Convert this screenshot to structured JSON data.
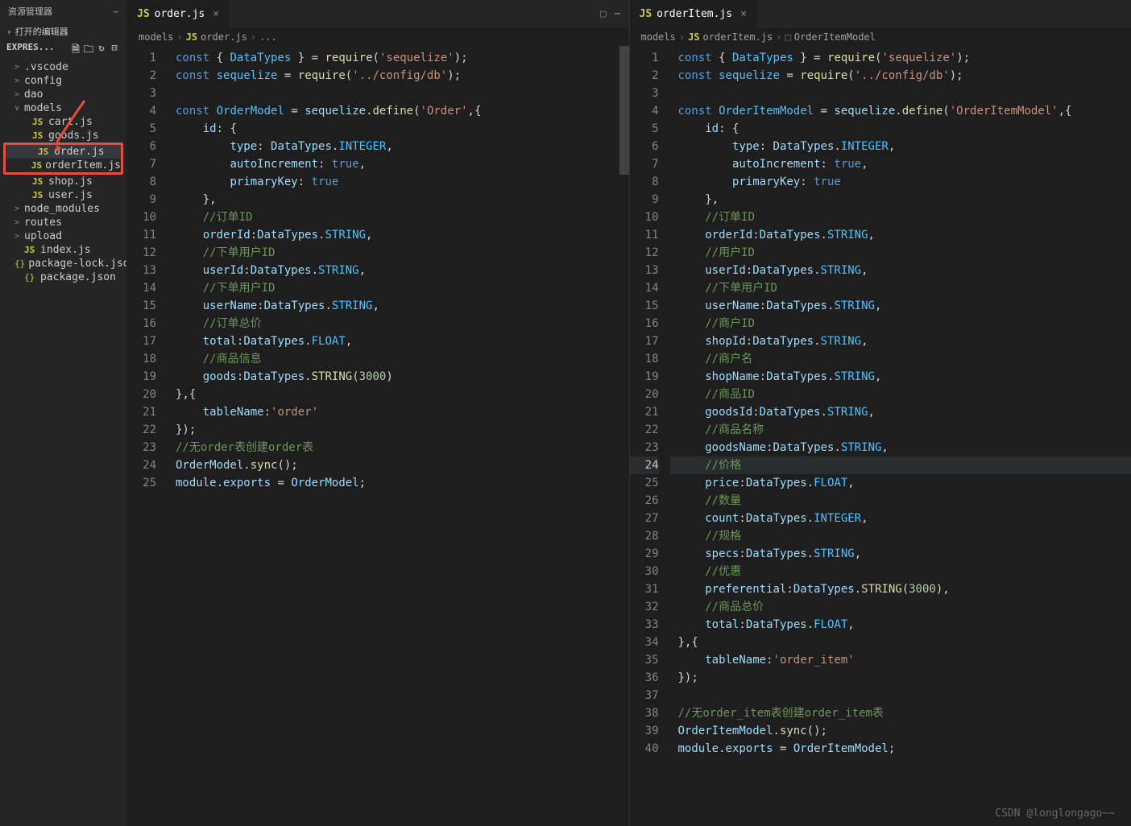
{
  "sidebar": {
    "title": "资源管理器",
    "openEditors": "打开的编辑器",
    "projectName": "EXPRES...",
    "items": [
      {
        "name": ".vscode",
        "type": "folder",
        "chev": ">"
      },
      {
        "name": "config",
        "type": "folder",
        "chev": ">"
      },
      {
        "name": "dao",
        "type": "folder",
        "chev": ">"
      },
      {
        "name": "models",
        "type": "folder",
        "chev": "∨",
        "open": true
      },
      {
        "name": "cart.js",
        "type": "js",
        "nested": true
      },
      {
        "name": "goods.js",
        "type": "js",
        "nested": true
      },
      {
        "name": "order.js",
        "type": "js",
        "nested": true,
        "hl": true,
        "selected": true
      },
      {
        "name": "orderItem.js",
        "type": "js",
        "nested": true,
        "hl": true
      },
      {
        "name": "shop.js",
        "type": "js",
        "nested": true
      },
      {
        "name": "user.js",
        "type": "js",
        "nested": true
      },
      {
        "name": "node_modules",
        "type": "folder",
        "chev": ">"
      },
      {
        "name": "routes",
        "type": "folder",
        "chev": ">"
      },
      {
        "name": "upload",
        "type": "folder",
        "chev": ">"
      },
      {
        "name": "index.js",
        "type": "js"
      },
      {
        "name": "package-lock.json",
        "type": "json"
      },
      {
        "name": "package.json",
        "type": "json"
      }
    ]
  },
  "leftPane": {
    "tab": "order.js",
    "breadcrumb": [
      "models",
      "order.js",
      "..."
    ],
    "lines": 25,
    "code": [
      "<span class='kw'>const</span> <span class='pn'>{</span> <span class='dc'>DataTypes</span> <span class='pn'>}</span> <span class='op'>=</span> <span class='fn'>require</span><span class='pn'>(</span><span class='str'>'sequelize'</span><span class='pn'>);</span>",
      "<span class='kw'>const</span> <span class='dc'>sequelize</span> <span class='op'>=</span> <span class='fn'>require</span><span class='pn'>(</span><span class='str'>'../config/db'</span><span class='pn'>);</span>",
      "",
      "<span class='kw'>const</span> <span class='dc'>OrderModel</span> <span class='op'>=</span> <span class='var'>sequelize</span><span class='pn'>.</span><span class='fn'>define</span><span class='pn'>(</span><span class='str'>'Order'</span><span class='pn'>,{</span>",
      "    <span class='prop'>id</span><span class='pn'>:</span> <span class='pn'>{</span>",
      "        <span class='prop'>type</span><span class='pn'>:</span> <span class='var'>DataTypes</span><span class='pn'>.</span><span class='dc'>INTEGER</span><span class='pn'>,</span>",
      "        <span class='prop'>autoIncrement</span><span class='pn'>:</span> <span class='kw'>true</span><span class='pn'>,</span>",
      "        <span class='prop'>primaryKey</span><span class='pn'>:</span> <span class='kw'>true</span>",
      "    <span class='pn'>},</span>",
      "    <span class='cmt'>//订单ID</span>",
      "    <span class='prop'>orderId</span><span class='pn'>:</span><span class='var'>DataTypes</span><span class='pn'>.</span><span class='dc'>STRING</span><span class='pn'>,</span>",
      "    <span class='cmt'>//下单用户ID</span>",
      "    <span class='prop'>userId</span><span class='pn'>:</span><span class='var'>DataTypes</span><span class='pn'>.</span><span class='dc'>STRING</span><span class='pn'>,</span>",
      "    <span class='cmt'>//下单用户ID</span>",
      "    <span class='prop'>userName</span><span class='pn'>:</span><span class='var'>DataTypes</span><span class='pn'>.</span><span class='dc'>STRING</span><span class='pn'>,</span>",
      "    <span class='cmt'>//订单总价</span>",
      "    <span class='prop'>total</span><span class='pn'>:</span><span class='var'>DataTypes</span><span class='pn'>.</span><span class='dc'>FLOAT</span><span class='pn'>,</span>",
      "    <span class='cmt'>//商品信息</span>",
      "    <span class='prop'>goods</span><span class='pn'>:</span><span class='var'>DataTypes</span><span class='pn'>.</span><span class='fn'>STRING</span><span class='pn'>(</span><span class='num'>3000</span><span class='pn'>)</span>",
      "<span class='pn'>},{</span>",
      "    <span class='prop'>tableName</span><span class='pn'>:</span><span class='str'>'order'</span>",
      "<span class='pn'>});</span>",
      "<span class='cmt'>//无order表创建order表</span>",
      "<span class='var'>OrderModel</span><span class='pn'>.</span><span class='fn'>sync</span><span class='pn'>();</span>",
      "<span class='var'>module</span><span class='pn'>.</span><span class='var'>exports</span> <span class='op'>=</span> <span class='var'>OrderModel</span><span class='pn'>;</span>"
    ]
  },
  "rightPane": {
    "tab": "orderItem.js",
    "breadcrumb": [
      "models",
      "orderItem.js",
      "OrderItemModel"
    ],
    "lines": 40,
    "currentLine": 24,
    "code": [
      "<span class='kw'>const</span> <span class='pn'>{</span> <span class='dc'>DataTypes</span> <span class='pn'>}</span> <span class='op'>=</span> <span class='fn'>require</span><span class='pn'>(</span><span class='str'>'sequelize'</span><span class='pn'>);</span>",
      "<span class='kw'>const</span> <span class='dc'>sequelize</span> <span class='op'>=</span> <span class='fn'>require</span><span class='pn'>(</span><span class='str'>'../config/db'</span><span class='pn'>);</span>",
      "",
      "<span class='kw'>const</span> <span class='dc'>OrderItemModel</span> <span class='op'>=</span> <span class='var'>sequelize</span><span class='pn'>.</span><span class='fn'>define</span><span class='pn'>(</span><span class='str'>'OrderItemModel'</span><span class='pn'>,{</span>",
      "    <span class='prop'>id</span><span class='pn'>:</span> <span class='pn'>{</span>",
      "        <span class='prop'>type</span><span class='pn'>:</span> <span class='var'>DataTypes</span><span class='pn'>.</span><span class='dc'>INTEGER</span><span class='pn'>,</span>",
      "        <span class='prop'>autoIncrement</span><span class='pn'>:</span> <span class='kw'>true</span><span class='pn'>,</span>",
      "        <span class='prop'>primaryKey</span><span class='pn'>:</span> <span class='kw'>true</span>",
      "    <span class='pn'>},</span>",
      "    <span class='cmt'>//订单ID</span>",
      "    <span class='prop'>orderId</span><span class='pn'>:</span><span class='var'>DataTypes</span><span class='pn'>.</span><span class='dc'>STRING</span><span class='pn'>,</span>",
      "    <span class='cmt'>//用户ID</span>",
      "    <span class='prop'>userId</span><span class='pn'>:</span><span class='var'>DataTypes</span><span class='pn'>.</span><span class='dc'>STRING</span><span class='pn'>,</span>",
      "    <span class='cmt'>//下单用户ID</span>",
      "    <span class='prop'>userName</span><span class='pn'>:</span><span class='var'>DataTypes</span><span class='pn'>.</span><span class='dc'>STRING</span><span class='pn'>,</span>",
      "    <span class='cmt'>//商户ID</span>",
      "    <span class='prop'>shopId</span><span class='pn'>:</span><span class='var'>DataTypes</span><span class='pn'>.</span><span class='dc'>STRING</span><span class='pn'>,</span>",
      "    <span class='cmt'>//商户名</span>",
      "    <span class='prop'>shopName</span><span class='pn'>:</span><span class='var'>DataTypes</span><span class='pn'>.</span><span class='dc'>STRING</span><span class='pn'>,</span>",
      "    <span class='cmt'>//商品ID</span>",
      "    <span class='prop'>goodsId</span><span class='pn'>:</span><span class='var'>DataTypes</span><span class='pn'>.</span><span class='dc'>STRING</span><span class='pn'>,</span>",
      "    <span class='cmt'>//商品名称</span>",
      "    <span class='prop'>goodsName</span><span class='pn'>:</span><span class='var'>DataTypes</span><span class='pn'>.</span><span class='dc'>STRING</span><span class='pn'>,</span>",
      "    <span class='cmt'>//价格</span>",
      "    <span class='prop'>price</span><span class='pn'>:</span><span class='var'>DataTypes</span><span class='pn'>.</span><span class='dc'>FLOAT</span><span class='pn'>,</span>",
      "    <span class='cmt'>//数量</span>",
      "    <span class='prop'>count</span><span class='pn'>:</span><span class='var'>DataTypes</span><span class='pn'>.</span><span class='dc'>INTEGER</span><span class='pn'>,</span>",
      "    <span class='cmt'>//规格</span>",
      "    <span class='prop'>specs</span><span class='pn'>:</span><span class='var'>DataTypes</span><span class='pn'>.</span><span class='dc'>STRING</span><span class='pn'>,</span>",
      "    <span class='cmt'>//优惠</span>",
      "    <span class='prop'>preferential</span><span class='pn'>:</span><span class='var'>DataTypes</span><span class='pn'>.</span><span class='fn'>STRING</span><span class='pn'>(</span><span class='num'>3000</span><span class='pn'>),</span>",
      "    <span class='cmt'>//商品总价</span>",
      "    <span class='prop'>total</span><span class='pn'>:</span><span class='var'>DataTypes</span><span class='pn'>.</span><span class='dc'>FLOAT</span><span class='pn'>,</span>",
      "<span class='pn'>},{</span>",
      "    <span class='prop'>tableName</span><span class='pn'>:</span><span class='str'>'order_item'</span>",
      "<span class='pn'>});</span>",
      "",
      "<span class='cmt'>//无order_item表创建order_item表</span>",
      "<span class='var'>OrderItemModel</span><span class='pn'>.</span><span class='fn'>sync</span><span class='pn'>();</span>",
      "<span class='var'>module</span><span class='pn'>.</span><span class='var'>exports</span> <span class='op'>=</span> <span class='var'>OrderItemModel</span><span class='pn'>;</span>"
    ]
  },
  "watermark": "CSDN @longlongago~~"
}
